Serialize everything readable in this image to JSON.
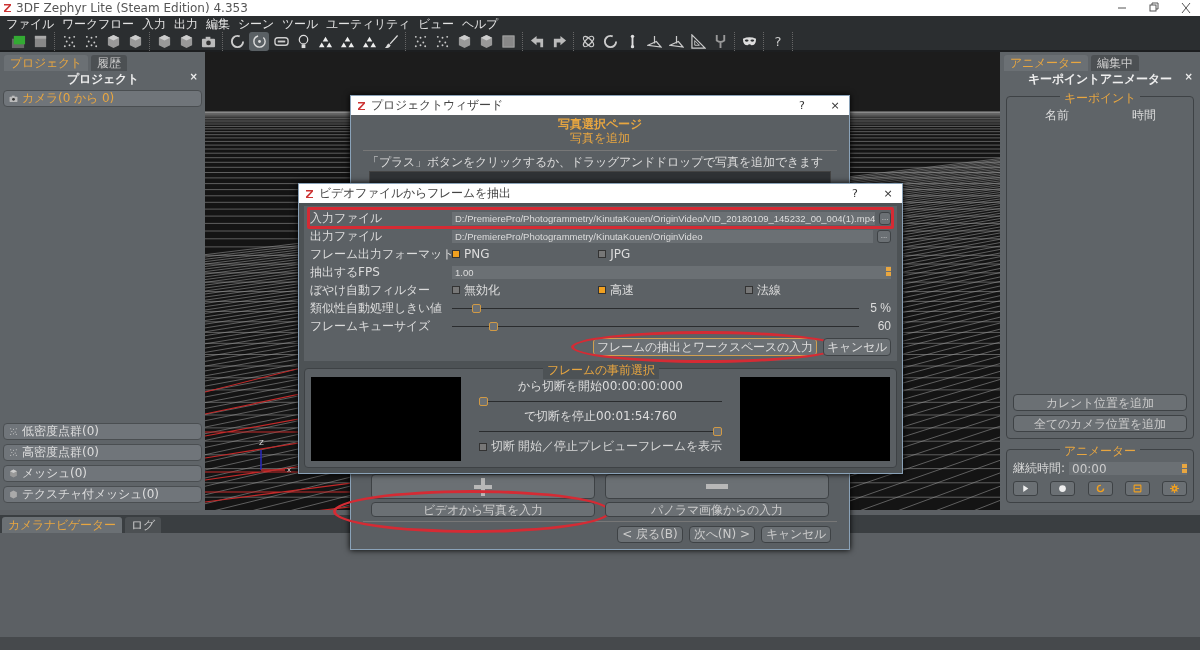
{
  "window": {
    "title": "3DF Zephyr Lite (Steam Edition) 4.353"
  },
  "menu": [
    "ファイル",
    "ワークフロー",
    "入力",
    "出力",
    "編集",
    "シーン",
    "ツール",
    "ユーティリティ",
    "ビュー",
    "ヘルプ"
  ],
  "toolbar": [
    [
      {
        "kind": "layers",
        "selected": false
      },
      {
        "kind": "panel",
        "selected": false
      }
    ],
    [
      {
        "kind": "dots",
        "selected": false
      },
      {
        "kind": "dots",
        "selected": false
      },
      {
        "kind": "cube",
        "selected": false
      },
      {
        "kind": "cube",
        "selected": false
      }
    ],
    [
      {
        "kind": "cube",
        "selected": false
      },
      {
        "kind": "cube",
        "selected": false
      },
      {
        "kind": "camera",
        "selected": false
      }
    ],
    [
      {
        "kind": "ring",
        "selected": false
      },
      {
        "kind": "target",
        "selected": true
      },
      {
        "kind": "rect",
        "selected": false
      },
      {
        "kind": "bulb",
        "selected": false
      },
      {
        "kind": "triangles",
        "selected": false
      },
      {
        "kind": "triangles",
        "selected": false
      },
      {
        "kind": "triangles",
        "selected": false
      },
      {
        "kind": "brush",
        "selected": false
      }
    ],
    [
      {
        "kind": "dots",
        "selected": false
      },
      {
        "kind": "dots",
        "selected": false
      },
      {
        "kind": "cube",
        "selected": false
      },
      {
        "kind": "cube",
        "selected": false
      },
      {
        "kind": "square",
        "selected": false
      }
    ],
    [
      {
        "kind": "undo",
        "selected": false
      },
      {
        "kind": "redo",
        "selected": false
      }
    ],
    [
      {
        "kind": "orbit",
        "selected": false
      },
      {
        "kind": "ring",
        "selected": false
      },
      {
        "kind": "pole",
        "selected": false
      },
      {
        "kind": "plane",
        "selected": false
      },
      {
        "kind": "plane",
        "selected": false
      },
      {
        "kind": "ruler",
        "selected": false
      },
      {
        "kind": "fork",
        "selected": false
      }
    ],
    [
      {
        "kind": "mask",
        "selected": false
      }
    ],
    [
      {
        "kind": "help",
        "label": "?",
        "selected": false
      }
    ]
  ],
  "left_panel": {
    "tabs": [
      {
        "label": "プロジェクト",
        "selected": true
      },
      {
        "label": "履歴",
        "selected": false
      }
    ],
    "title": "プロジェクト",
    "close": "×",
    "top_items": [
      {
        "kind": "camera",
        "label": "カメラ(0  から  0)",
        "active": true
      }
    ],
    "bottom_items": [
      {
        "kind": "dots",
        "label": "低密度点群(0)",
        "active": false
      },
      {
        "kind": "dots",
        "label": "高密度点群(0)",
        "active": false
      },
      {
        "kind": "cube",
        "label": "メッシュ(0)",
        "active": false
      },
      {
        "kind": "texture",
        "label": "テクスチャ付メッシュ(0)",
        "active": false
      }
    ]
  },
  "viewport": {
    "axes": [
      "Z",
      "x"
    ]
  },
  "right_panel": {
    "tabs": [
      {
        "label": "アニメーター",
        "selected": true
      },
      {
        "label": "編集中",
        "selected": false
      }
    ],
    "title": "キーポイントアニメーター",
    "close": "×",
    "keypoints": {
      "title": "キーポイント",
      "columns": [
        "名前",
        "時間"
      ],
      "buttons": [
        "カレント位置を追加",
        "全てのカメラ位置を追加"
      ]
    },
    "animator": {
      "title": "アニメーター",
      "duration_label": "継続時間:",
      "duration": "00:00",
      "controls": [
        {
          "kind": "play",
          "accent": false
        },
        {
          "kind": "record",
          "accent": false
        },
        {
          "kind": "loop",
          "accent": true
        },
        {
          "kind": "film",
          "accent": true
        },
        {
          "kind": "gear",
          "accent": true
        }
      ]
    }
  },
  "bottom_panel": {
    "tabs": [
      {
        "label": "カメラナビゲーター",
        "selected": true
      },
      {
        "label": "ログ",
        "selected": false
      }
    ]
  },
  "wizard": {
    "title": "プロジェクトウィザード",
    "help": "?",
    "close": "×",
    "heading": "写真選択ページ",
    "subheading": "写真を追加",
    "hint": "「プラス」ボタンをクリックするか、ドラッグアンドドロップで写真を追加できます",
    "import_buttons": [
      {
        "label": "ビデオから写真を入力",
        "highlighted": true
      },
      {
        "label": "パノラマ画像からの入力",
        "highlighted": false
      }
    ],
    "nav_buttons": [
      "< 戻る(B)",
      "次へ(N) >",
      "キャンセル"
    ]
  },
  "video_dialog": {
    "title": "ビデオファイルからフレームを抽出",
    "help": "?",
    "close": "×",
    "rows": [
      {
        "kind": "path",
        "label": "入力ファイル",
        "value": "D:/PremierePro/Photogrammetry/KinutaKouen/OriginVideo/VID_20180109_145232_00_004(1).mp4",
        "button": "...",
        "highlighted": true
      },
      {
        "kind": "path",
        "label": "出力ファイル",
        "value": "D:/PremierePro/Photogrammetry/KinutaKouen/OriginVideo",
        "button": "...",
        "highlighted": false
      },
      {
        "kind": "choice",
        "label": "フレーム出力フォーマット",
        "options": [
          {
            "label": "PNG",
            "checked": true
          },
          {
            "label": "JPG",
            "checked": false
          }
        ]
      },
      {
        "kind": "spin",
        "label": "抽出するFPS",
        "value": "1.00"
      },
      {
        "kind": "choice",
        "label": "ぼやけ自動フィルター",
        "options": [
          {
            "label": "無効化",
            "checked": false
          },
          {
            "label": "高速",
            "checked": true
          },
          {
            "label": "法線",
            "checked": false
          }
        ]
      },
      {
        "kind": "slider",
        "label": "類似性自動処理しきい値",
        "level": 0.06,
        "reading": "5 %"
      },
      {
        "kind": "slider",
        "label": "フレームキューサイズ",
        "level": 0.1,
        "reading": "60"
      }
    ],
    "buttons": [
      {
        "label": "フレームの抽出とワークスペースの入力",
        "highlighted": true
      },
      {
        "label": "キャンセル",
        "highlighted": false
      }
    ],
    "preview": {
      "title": "フレームの事前選択",
      "sliders": [
        {
          "label": "から切断を開始00:00:00:000",
          "level": 0
        },
        {
          "label": "で切断を停止00:01:54:760",
          "level": 1
        }
      ],
      "checkbox": {
        "label": "切断 開始／停止プレビューフレームを表示",
        "checked": false
      }
    }
  }
}
